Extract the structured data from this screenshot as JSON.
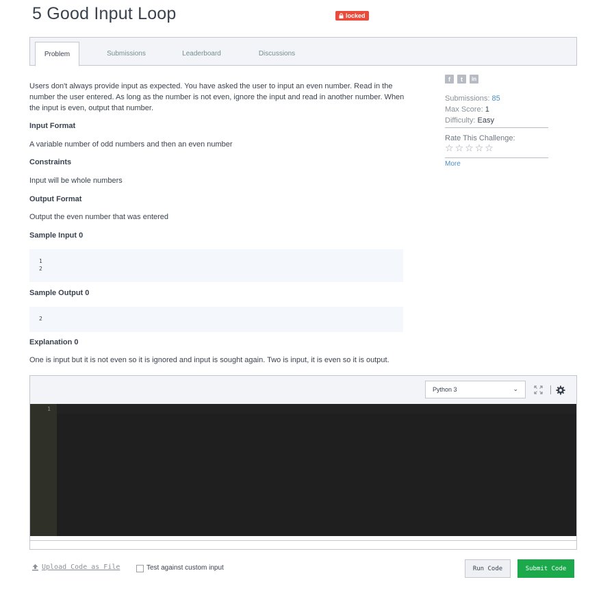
{
  "header": {
    "title": "5 Good Input Loop",
    "badge": "locked"
  },
  "tabs": [
    {
      "label": "Problem",
      "active": true
    },
    {
      "label": "Submissions",
      "active": false
    },
    {
      "label": "Leaderboard",
      "active": false
    },
    {
      "label": "Discussions",
      "active": false
    }
  ],
  "problem": {
    "description": "Users don't always provide input as expected. You have asked the user to input an even number. Read in the number the user entered. As long as the number is not even, ignore the input and read in another number. When the input is even, output that number.",
    "input_format_heading": "Input Format",
    "input_format": "A variable number of odd numbers and then an even number",
    "constraints_heading": "Constraints",
    "constraints": "Input will be whole numbers",
    "output_format_heading": "Output Format",
    "output_format": "Output the even number that was entered",
    "sample_input_heading": "Sample Input 0",
    "sample_input_lines": [
      "1",
      "2"
    ],
    "sample_output_heading": "Sample Output 0",
    "sample_output_lines": [
      "2"
    ],
    "explanation_heading": "Explanation 0",
    "explanation": "One is input but it is not even so it is ignored and input is sought again. Two is input, it is even so it is output."
  },
  "sidebar": {
    "social_icons": [
      "facebook-icon",
      "twitter-icon",
      "linkedin-icon"
    ],
    "social_glyphs": [
      "f",
      "t",
      "in"
    ],
    "submissions_label": "Submissions:",
    "submissions_value": "85",
    "max_score_label": "Max Score:",
    "max_score_value": "1",
    "difficulty_label": "Difficulty:",
    "difficulty_value": "Easy",
    "rate_label": "Rate This Challenge:",
    "star_glyph": "☆",
    "more_link": "More"
  },
  "editor": {
    "language": "Python 3",
    "chevron": "⌄",
    "line_numbers": [
      "1"
    ]
  },
  "footer": {
    "upload_label": "Upload Code as File",
    "custom_input_label": "Test against custom input",
    "run_label": "Run Code",
    "submit_label": "Submit Code"
  },
  "colors": {
    "badge": "#e94c3c",
    "submit": "#1ba94c",
    "link": "#4c8ec2",
    "editor_bg": "#1f1f1f"
  }
}
